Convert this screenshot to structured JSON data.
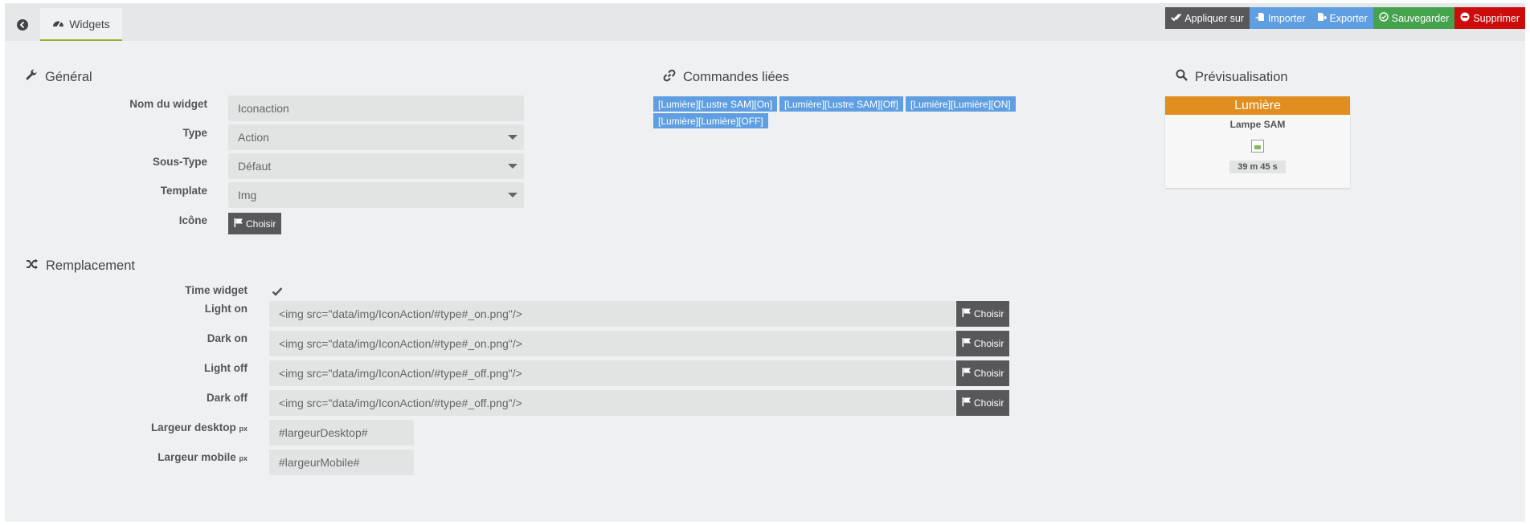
{
  "tabs": {
    "widgets_label": "Widgets"
  },
  "actions": {
    "apply": "Appliquer sur",
    "import": "Importer",
    "export": "Exporter",
    "save": "Sauvegarder",
    "delete": "Supprimer"
  },
  "general": {
    "title": "Général",
    "name_label": "Nom du widget",
    "name_value": "Iconaction",
    "type_label": "Type",
    "type_value": "Action",
    "subtype_label": "Sous-Type",
    "subtype_value": "Défaut",
    "template_label": "Template",
    "template_value": "Img",
    "icon_label": "Icône",
    "choose_label": "Choisir"
  },
  "linked": {
    "title": "Commandes liées",
    "commands": [
      "[Lumière][Lustre SAM][On]",
      "[Lumière][Lustre SAM][Off]",
      "[Lumière][Lumière][ON]",
      "[Lumière][Lumière][OFF]"
    ]
  },
  "preview": {
    "title": "Prévisualisation",
    "tile_title": "Lumière",
    "tile_subtitle": "Lampe SAM",
    "tile_time": "39 m 45 s"
  },
  "replacement": {
    "title": "Remplacement",
    "time_widget_label": "Time widget",
    "time_widget_checked": true,
    "choose_label": "Choisir",
    "light_on_label": "Light on",
    "light_on_value": "<img src=\"data/img/IconAction/#type#_on.png\"/>",
    "dark_on_label": "Dark on",
    "dark_on_value": "<img src=\"data/img/IconAction/#type#_on.png\"/>",
    "light_off_label": "Light off",
    "light_off_value": "<img src=\"data/img/IconAction/#type#_off.png\"/>",
    "dark_off_label": "Dark off",
    "dark_off_value": "<img src=\"data/img/IconAction/#type#_off.png\"/>",
    "width_desktop_label": "Largeur desktop",
    "width_desktop_value": "#largeurDesktop#",
    "width_mobile_label": "Largeur mobile",
    "width_mobile_value": "#largeurMobile#",
    "unit": "px"
  },
  "colors": {
    "accent_tab": "#94b22a",
    "apply": "#58585a",
    "import_export": "#5f9fe1",
    "save": "#45a24d",
    "delete": "#cc0c0c",
    "preview_header": "#e08e1f",
    "badge": "#5f9fe1"
  }
}
